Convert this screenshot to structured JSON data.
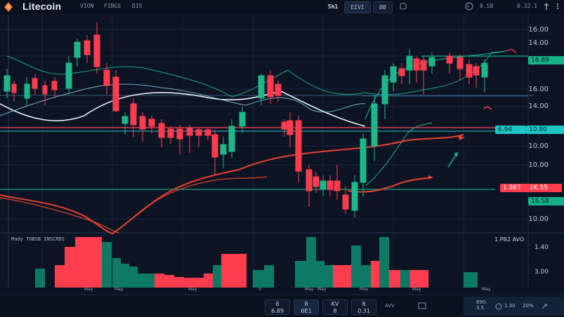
{
  "app": {
    "title": "Litecoin"
  },
  "top_nav": {
    "items": [
      "VION",
      "FIBGS",
      "DIS"
    ]
  },
  "top_buttons": {
    "a": "5h1",
    "b": "EIVI",
    "c": "ØØ"
  },
  "top_right": {
    "v1": "0.S8",
    "v2": "0.32.1"
  },
  "price_axis": {
    "labels": [
      "16.00",
      "14.00",
      "16.00",
      "14.00",
      "10.00",
      "10.00",
      "10.00"
    ]
  },
  "price_tags": {
    "green_top": "16.89",
    "cyan_left": "6.94",
    "cyan_right": "10.80",
    "red_left": "1.887",
    "red_right": "1K.55",
    "green_low": "16.S8",
    "vol_header": "1.PB2 AVO"
  },
  "volume_axis": {
    "labels": [
      "1.40",
      "3.00"
    ]
  },
  "volume_title": "Mady TOBSB INSCRDS",
  "time_axis": {
    "labels": [
      "May",
      "May",
      "May",
      "V",
      "May",
      "May",
      "May",
      "May",
      "May"
    ]
  },
  "bottom_buttons": [
    "8\n6.89",
    "8\n6E1",
    "KV\n8",
    "8\n0.31"
  ],
  "bottom_right": {
    "v1": "AVV",
    "v2": "690.\n3.5",
    "v3": "1.30",
    "v4": "20%"
  },
  "colors": {
    "bull": "#1bb88a",
    "bear": "#ff3b4e",
    "bg": "#0c1424",
    "line_white": "#e9eef8",
    "ma_red": "#e8432f"
  }
}
